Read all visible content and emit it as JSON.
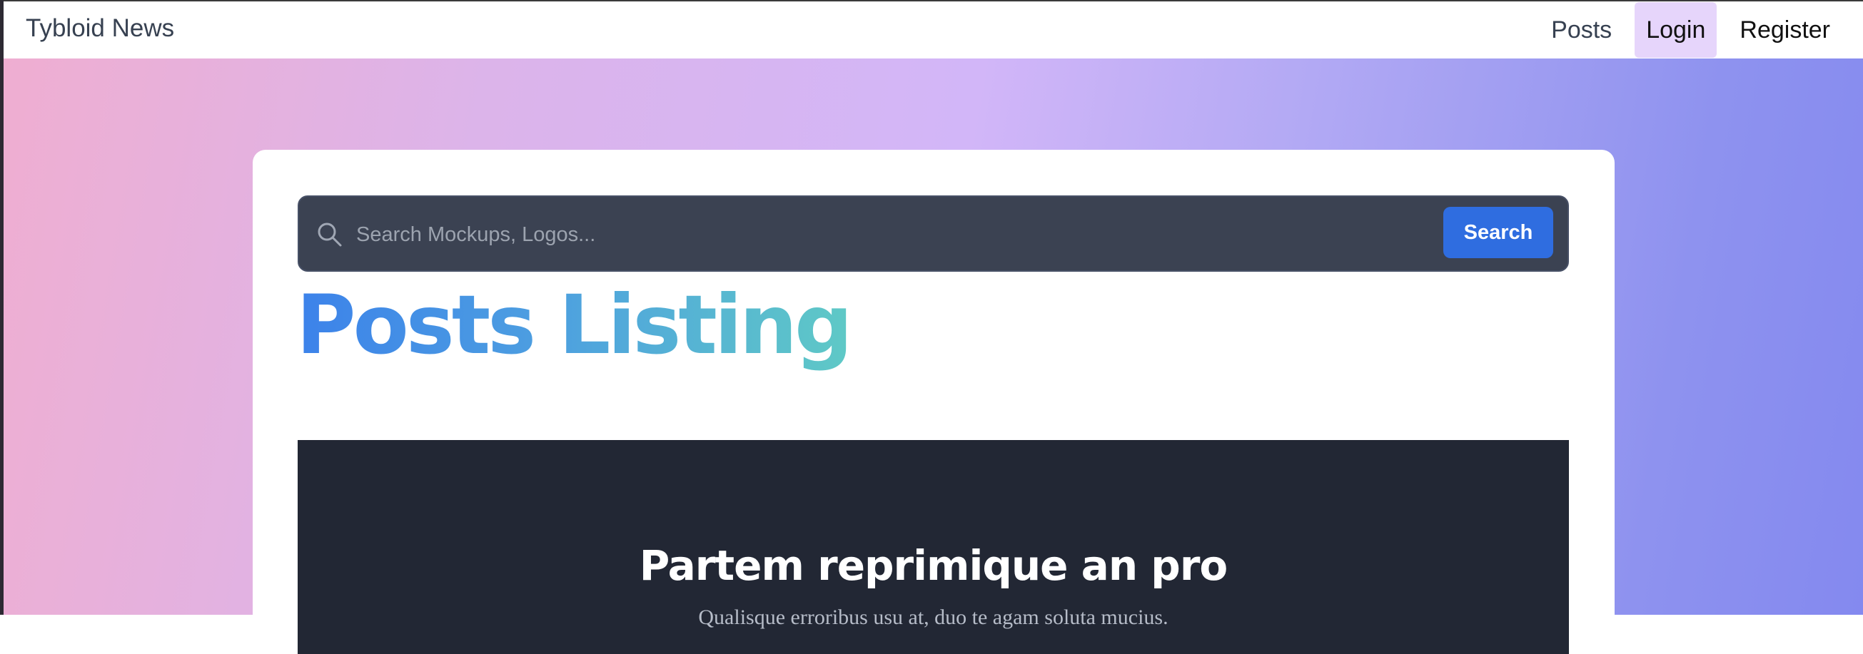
{
  "navbar": {
    "brand": "Tybloid News",
    "links": {
      "posts": "Posts",
      "login": "Login",
      "register": "Register"
    }
  },
  "search": {
    "placeholder": "Search Mockups, Logos...",
    "value": "",
    "button_label": "Search",
    "icon": "search-icon"
  },
  "page": {
    "title": "Posts Listing"
  },
  "posts": [
    {
      "title": "Partem reprimique an pro",
      "subtitle": "Qualisque erroribus usu at, duo te agam soluta mucius."
    }
  ],
  "colors": {
    "accent_button": "#2f6de0",
    "login_highlight": "#e6d5fb",
    "search_bar": "#3b4252",
    "post_card": "#222734",
    "title_gradient_start": "#3c82ea",
    "title_gradient_end": "#5fc9c6"
  }
}
